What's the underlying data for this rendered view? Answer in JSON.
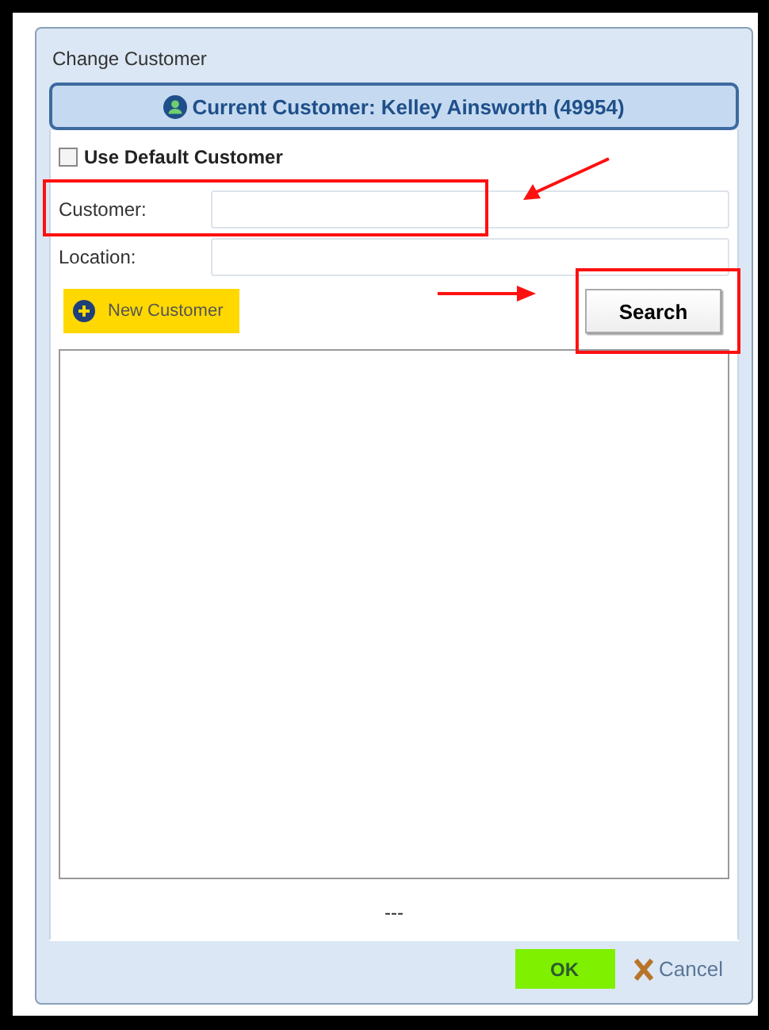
{
  "window": {
    "title": "Change Customer"
  },
  "current_customer": "Current Customer: Kelley Ainsworth (49954)",
  "use_default": {
    "label": "Use Default Customer",
    "checked": false
  },
  "fields": [
    {
      "label": "Customer:"
    },
    {
      "label": "Location:"
    }
  ],
  "new_customer_button": "New Customer",
  "search_button": "Search",
  "status": "---",
  "buttons": [
    {
      "label": "OK",
      "kind": "ok"
    },
    {
      "label": "Cancel",
      "kind": "cancel"
    }
  ]
}
